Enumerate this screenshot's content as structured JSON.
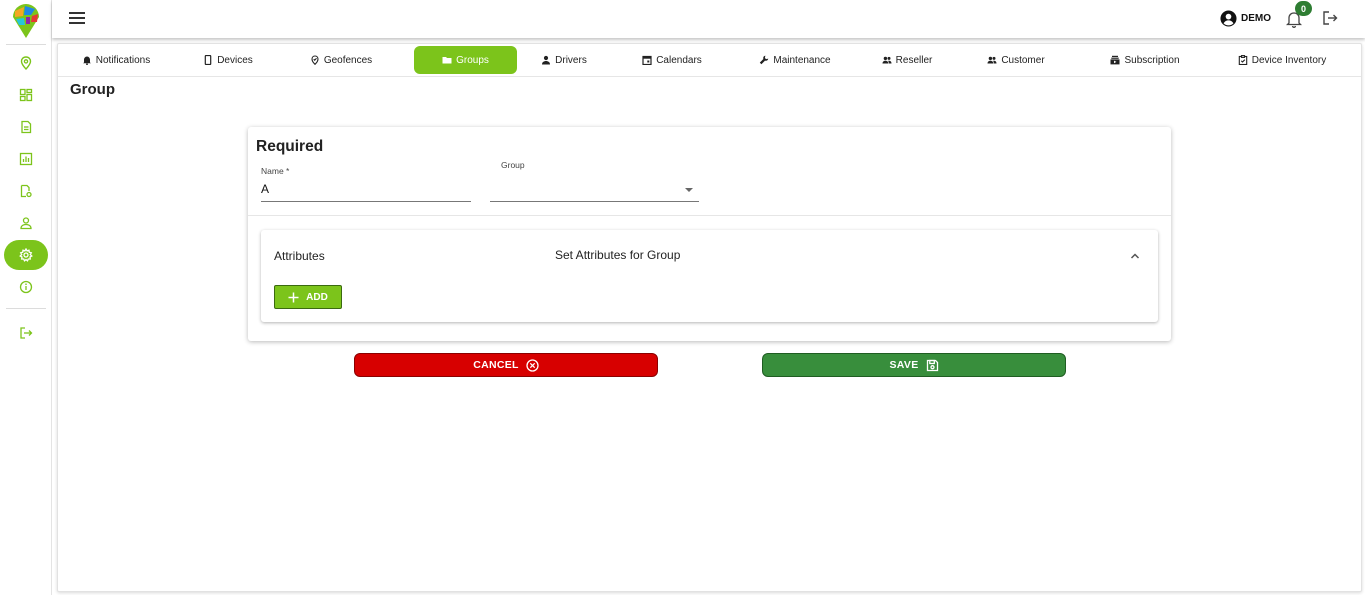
{
  "colors": {
    "accent": "#7cc41b",
    "cancel": "#d70000",
    "save": "#388e3c",
    "badge": "#2e7d32"
  },
  "sidebar": {
    "items": [
      {
        "icon": "map-pin-icon"
      },
      {
        "icon": "dashboard-icon"
      },
      {
        "icon": "document-icon"
      },
      {
        "icon": "chart-icon"
      },
      {
        "icon": "report-settings-icon"
      },
      {
        "icon": "user-icon"
      },
      {
        "icon": "gear-icon",
        "active": true
      },
      {
        "icon": "info-icon"
      },
      {
        "icon": "logout-icon"
      }
    ]
  },
  "header": {
    "user_name": "DEMO",
    "notification_count": "0"
  },
  "tabs": [
    {
      "label": "Notifications",
      "icon": "bell-icon"
    },
    {
      "label": "Devices",
      "icon": "phone-icon"
    },
    {
      "label": "Geofences",
      "icon": "geofence-icon"
    },
    {
      "label": "Groups",
      "icon": "folder-icon",
      "active": true
    },
    {
      "label": "Drivers",
      "icon": "person-icon"
    },
    {
      "label": "Calendars",
      "icon": "calendar-icon"
    },
    {
      "label": "Maintenance",
      "icon": "wrench-icon"
    },
    {
      "label": "Reseller",
      "icon": "people-icon"
    },
    {
      "label": "Customer",
      "icon": "people-icon"
    },
    {
      "label": "Subscription",
      "icon": "subscription-icon"
    },
    {
      "label": "Device Inventory",
      "icon": "inventory-icon"
    }
  ],
  "page": {
    "title": "Group"
  },
  "form": {
    "section_title": "Required",
    "name_label": "Name *",
    "name_value": "A",
    "group_label": "Group",
    "group_value": ""
  },
  "attributes": {
    "title": "Attributes",
    "subtitle": "Set Attributes for Group",
    "add_label": "ADD",
    "expanded": true
  },
  "actions": {
    "cancel_label": "CANCEL",
    "save_label": "SAVE"
  }
}
